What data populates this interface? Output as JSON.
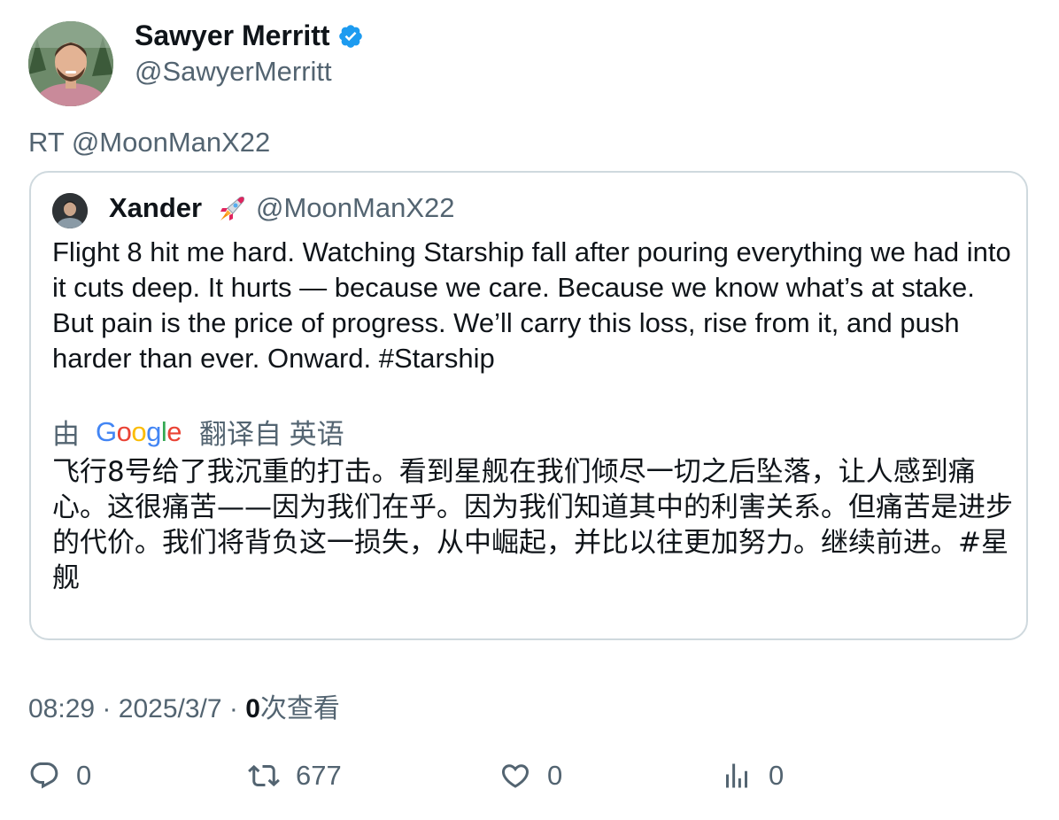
{
  "author": {
    "name": "Sawyer Merritt",
    "handle": "@SawyerMerritt",
    "verified_icon": "verified-badge-icon",
    "verified_color": "#1d9bf0"
  },
  "retweet_line": "RT @MoonManX22",
  "quote": {
    "name": "Xander",
    "emoji_icon": "rocket-icon",
    "handle": "@MoonManX22",
    "text": "Flight 8 hit me hard. Watching Starship fall after pouring everything we had into it cuts deep. It hurts — because we care. Because we know what’s at stake. But pain is the price of progress. We’ll carry this loss, rise from it, and push harder than ever. Onward. #Starship",
    "translate_prefix": "由",
    "translate_suffix": "翻译自 英语",
    "translation": "飞行8号给了我沉重的打击。看到星舰在我们倾尽一切之后坠落，让人感到痛心。这很痛苦——因为我们在乎。因为我们知道其中的利害关系。但痛苦是进步的代价。我们将背负这一损失，从中崛起，并比以往更加努力。继续前进。#星舰"
  },
  "meta": {
    "time": "08:29",
    "date": "2025/3/7",
    "views": "0",
    "views_label": "次查看",
    "separator": "·"
  },
  "actions": {
    "reply_count": "0",
    "retweet_count": "677",
    "like_count": "0",
    "views_count": "0"
  },
  "colors": {
    "secondary_text": "#536471",
    "border": "#cfd9de"
  }
}
